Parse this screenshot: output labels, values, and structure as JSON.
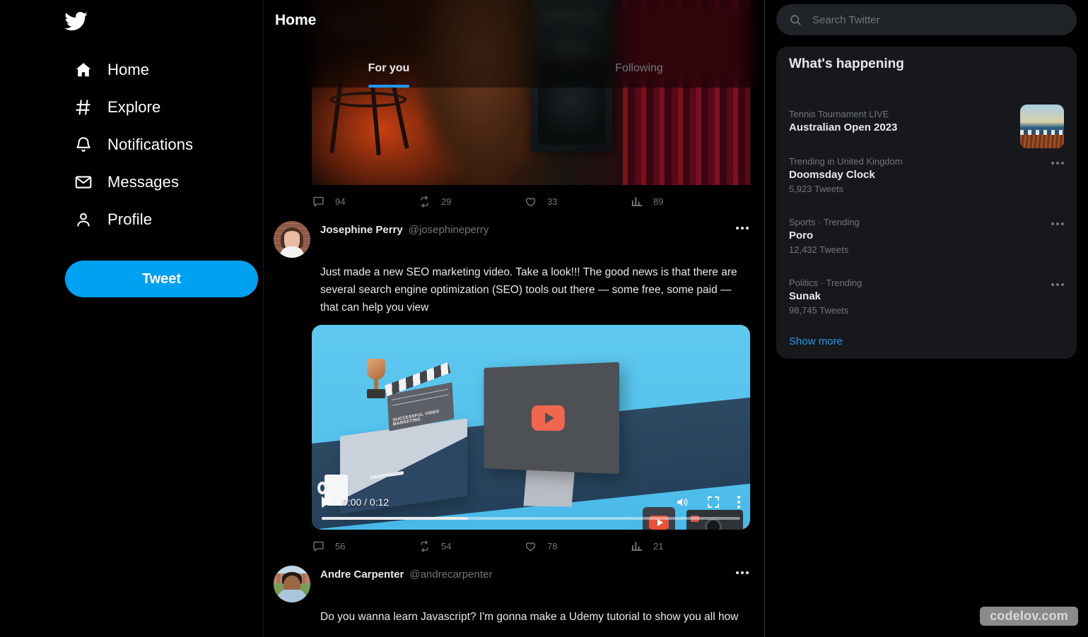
{
  "brand": {
    "logo_icon": "twitter-bird-icon",
    "accent_color": "#1d9bf0",
    "tweet_button_color": "#00a1f1"
  },
  "sidebar": {
    "items": [
      {
        "label": "Home",
        "icon": "home-icon",
        "active": true
      },
      {
        "label": "Explore",
        "icon": "hashtag-icon",
        "active": false
      },
      {
        "label": "Notifications",
        "icon": "bell-icon",
        "active": false
      },
      {
        "label": "Messages",
        "icon": "envelope-icon",
        "active": false
      },
      {
        "label": "Profile",
        "icon": "person-icon",
        "active": false
      }
    ],
    "tweet_button": "Tweet"
  },
  "feed": {
    "title": "Home",
    "tabs": [
      {
        "label": "For you",
        "active": true
      },
      {
        "label": "Following",
        "active": false
      }
    ],
    "tweets": [
      {
        "id": "tweet-partial-top",
        "media_type": "image",
        "media_alt": "guitarist on stool beside Fender amplifier with red stage curtain",
        "actions": {
          "reply": "94",
          "retweet": "29",
          "like": "33",
          "views": "89"
        }
      },
      {
        "id": "tweet-josephine",
        "display_name": "Josephine Perry",
        "handle": "@josephineperry",
        "avatar_alt": "woman smiling in front of brick wall",
        "text": "Just made a new SEO marketing video. Take a look!!! The good news is that there are several search engine optimization (SEO) tools out there — some free, some paid — that can help you view",
        "media_type": "video",
        "media_alt": "isometric illustration of desk with monitor showing play button, trophy, clapperboard and camera",
        "clapperboard_label": "SUCCESSFUL VIDEO MARKETING",
        "video": {
          "current_time": "0:00",
          "duration": "0:12",
          "time_display": "0:00 / 0:12",
          "progress_percent": 35,
          "play_icon": "play-icon",
          "volume_icon": "volume-icon",
          "fullscreen_icon": "fullscreen-icon",
          "menu_icon": "kebab-menu-icon"
        },
        "actions": {
          "reply": "56",
          "retweet": "54",
          "like": "78",
          "views": "21"
        }
      },
      {
        "id": "tweet-andre",
        "display_name": "Andre Carpenter",
        "handle": "@andrecarpenter",
        "avatar_alt": "man in light blue shirt outdoors",
        "text": "Do you wanna learn Javascript? I'm gonna make a Udemy tutorial to show you all how"
      }
    ],
    "action_icons": {
      "reply": "comment-icon",
      "retweet": "retweet-icon",
      "like": "heart-icon",
      "views": "analytics-icon"
    },
    "more_icon": "more-options-icon"
  },
  "search": {
    "placeholder": "Search Twitter",
    "value": "",
    "icon": "search-icon"
  },
  "whats_happening": {
    "title": "What's happening",
    "items": [
      {
        "category": "Tennis Tournament LIVE",
        "name": "Australian Open 2023",
        "count": "",
        "has_thumbnail": true,
        "thumbnail_alt": "coastal landscape with birds and reeds at dusk"
      },
      {
        "category": "Trending in United Kingdom",
        "name": "Doomsday Clock",
        "count": "5,923 Tweets",
        "has_thumbnail": false
      },
      {
        "category": "Sports · Trending",
        "name": "Poro",
        "count": "12,432 Tweets",
        "has_thumbnail": false
      },
      {
        "category": "Politics · Trending",
        "name": "Sunak",
        "count": "98,745 Tweets",
        "has_thumbnail": false
      }
    ],
    "show_more": "Show more"
  },
  "watermark": {
    "text": "codelov.com"
  }
}
